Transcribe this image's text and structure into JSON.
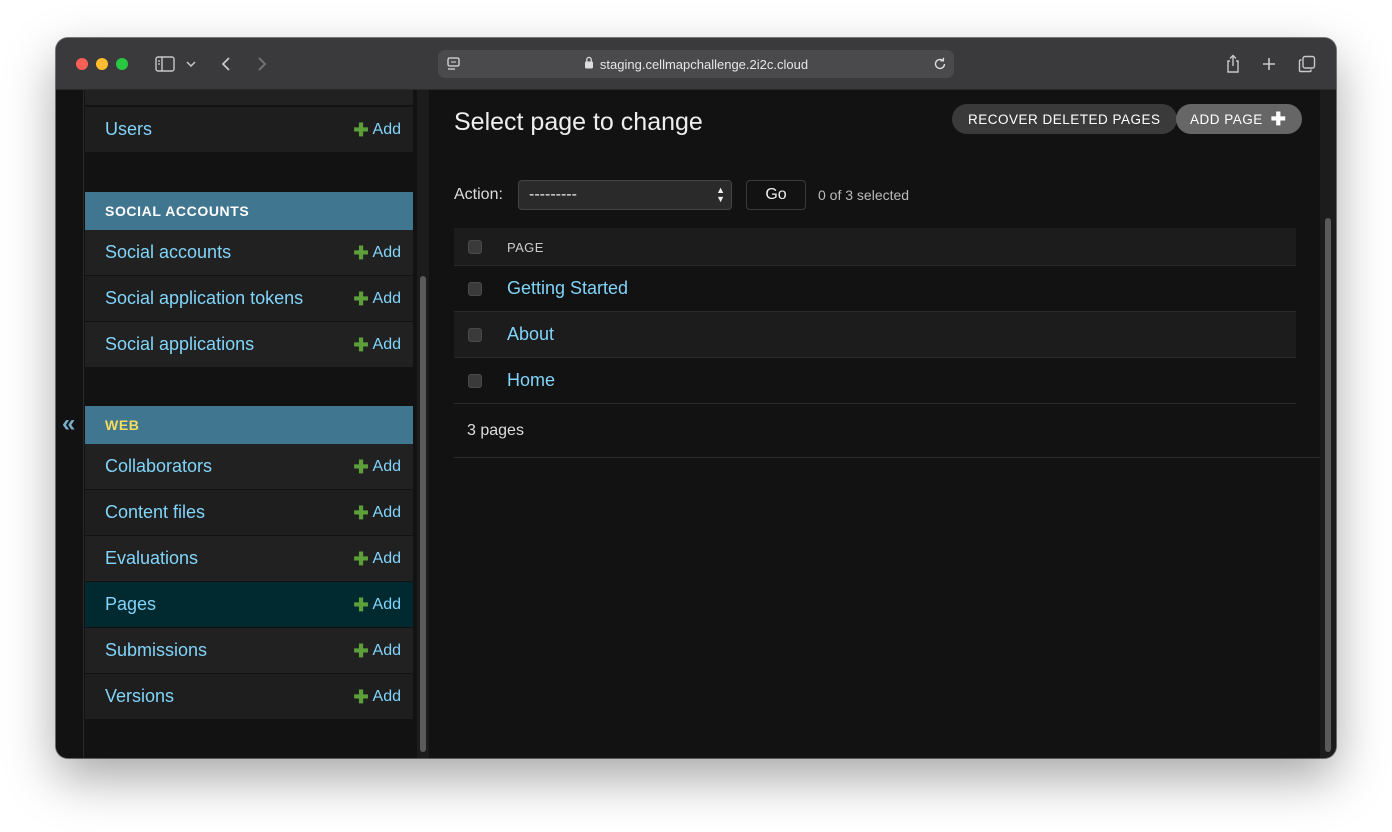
{
  "browser": {
    "url": "staging.cellmapchallenge.2i2c.cloud"
  },
  "sidebar": {
    "auth_items": [
      {
        "label": "Users",
        "add": "Add"
      }
    ],
    "social_header": "SOCIAL ACCOUNTS",
    "social_items": [
      {
        "label": "Social accounts",
        "add": "Add"
      },
      {
        "label": "Social application tokens",
        "add": "Add"
      },
      {
        "label": "Social applications",
        "add": "Add"
      }
    ],
    "web_header": "WEB",
    "web_items": [
      {
        "label": "Collaborators",
        "add": "Add"
      },
      {
        "label": "Content files",
        "add": "Add"
      },
      {
        "label": "Evaluations",
        "add": "Add"
      },
      {
        "label": "Pages",
        "add": "Add"
      },
      {
        "label": "Submissions",
        "add": "Add"
      },
      {
        "label": "Versions",
        "add": "Add"
      }
    ],
    "active_item": "Pages",
    "collapse_glyph": "«"
  },
  "main": {
    "title": "Select page to change",
    "recover_button": "RECOVER DELETED PAGES",
    "add_button": "ADD PAGE",
    "action_label": "Action:",
    "action_value": "---------",
    "go_button": "Go",
    "selected_count": "0 of 3 selected",
    "column_header": "PAGE",
    "rows": [
      "Getting Started",
      "About",
      "Home"
    ],
    "paginator": "3 pages"
  },
  "colors": {
    "link": "#81d4fa",
    "module_header": "#417690",
    "add_plus": "#5da03a",
    "active_row": "#002a2f"
  }
}
